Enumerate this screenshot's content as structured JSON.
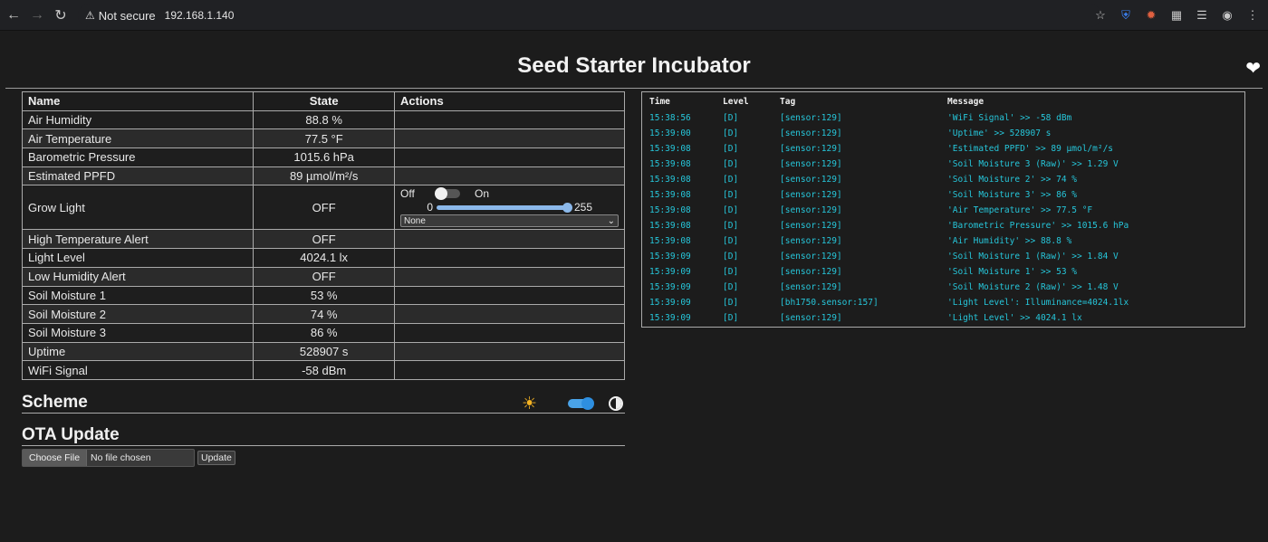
{
  "browser": {
    "security_label": "Not secure",
    "url": "192.168.1.140"
  },
  "page": {
    "title": "Seed Starter Incubator"
  },
  "entities": {
    "headers": {
      "name": "Name",
      "state": "State",
      "actions": "Actions"
    },
    "rows": [
      {
        "name": "Air Humidity",
        "state": "88.8 %"
      },
      {
        "name": "Air Temperature",
        "state": "77.5 °F"
      },
      {
        "name": "Barometric Pressure",
        "state": "1015.6 hPa"
      },
      {
        "name": "Estimated PPFD",
        "state": "89 µmol/m²/s"
      },
      {
        "name": "Grow Light",
        "state": "OFF"
      },
      {
        "name": "High Temperature Alert",
        "state": "OFF"
      },
      {
        "name": "Light Level",
        "state": "4024.1 lx"
      },
      {
        "name": "Low Humidity Alert",
        "state": "OFF"
      },
      {
        "name": "Soil Moisture 1",
        "state": "53 %"
      },
      {
        "name": "Soil Moisture 2",
        "state": "74 %"
      },
      {
        "name": "Soil Moisture 3",
        "state": "86 %"
      },
      {
        "name": "Uptime",
        "state": "528907 s"
      },
      {
        "name": "WiFi Signal",
        "state": "-58 dBm"
      }
    ],
    "grow_light_actions": {
      "off_label": "Off",
      "on_label": "On",
      "toggle_on": false,
      "slider_min": "0",
      "slider_max": "255",
      "slider_value": 255,
      "effect_select": "None"
    }
  },
  "scheme": {
    "heading": "Scheme",
    "dark_mode": true
  },
  "ota": {
    "heading": "OTA Update",
    "choose_label": "Choose File",
    "no_file_label": "No file chosen",
    "update_label": "Update"
  },
  "log": {
    "headers": {
      "time": "Time",
      "level": "Level",
      "tag": "Tag",
      "message": "Message"
    },
    "rows": [
      {
        "time": "15:38:56",
        "level": "[D]",
        "tag": "[sensor:129]",
        "message": "'WiFi Signal' >> -58 dBm"
      },
      {
        "time": "15:39:00",
        "level": "[D]",
        "tag": "[sensor:129]",
        "message": "'Uptime' >> 528907 s"
      },
      {
        "time": "15:39:08",
        "level": "[D]",
        "tag": "[sensor:129]",
        "message": "'Estimated PPFD' >> 89 µmol/m²/s"
      },
      {
        "time": "15:39:08",
        "level": "[D]",
        "tag": "[sensor:129]",
        "message": "'Soil Moisture 3 (Raw)' >> 1.29 V"
      },
      {
        "time": "15:39:08",
        "level": "[D]",
        "tag": "[sensor:129]",
        "message": "'Soil Moisture 2' >> 74 %"
      },
      {
        "time": "15:39:08",
        "level": "[D]",
        "tag": "[sensor:129]",
        "message": "'Soil Moisture 3' >> 86 %"
      },
      {
        "time": "15:39:08",
        "level": "[D]",
        "tag": "[sensor:129]",
        "message": "'Air Temperature' >> 77.5 °F"
      },
      {
        "time": "15:39:08",
        "level": "[D]",
        "tag": "[sensor:129]",
        "message": "'Barometric Pressure' >> 1015.6 hPa"
      },
      {
        "time": "15:39:08",
        "level": "[D]",
        "tag": "[sensor:129]",
        "message": "'Air Humidity' >> 88.8 %"
      },
      {
        "time": "15:39:09",
        "level": "[D]",
        "tag": "[sensor:129]",
        "message": "'Soil Moisture 1 (Raw)' >> 1.84 V"
      },
      {
        "time": "15:39:09",
        "level": "[D]",
        "tag": "[sensor:129]",
        "message": "'Soil Moisture 1' >> 53 %"
      },
      {
        "time": "15:39:09",
        "level": "[D]",
        "tag": "[sensor:129]",
        "message": "'Soil Moisture 2 (Raw)' >> 1.48 V"
      },
      {
        "time": "15:39:09",
        "level": "[D]",
        "tag": "[bh1750.sensor:157]",
        "message": "'Light Level': Illuminance=4024.1lx"
      },
      {
        "time": "15:39:09",
        "level": "[D]",
        "tag": "[sensor:129]",
        "message": "'Light Level' >> 4024.1 lx"
      }
    ]
  },
  "colors": {
    "log_text": "#26c6da",
    "accent": "#2e8fe0",
    "sun": "#f5b323"
  }
}
